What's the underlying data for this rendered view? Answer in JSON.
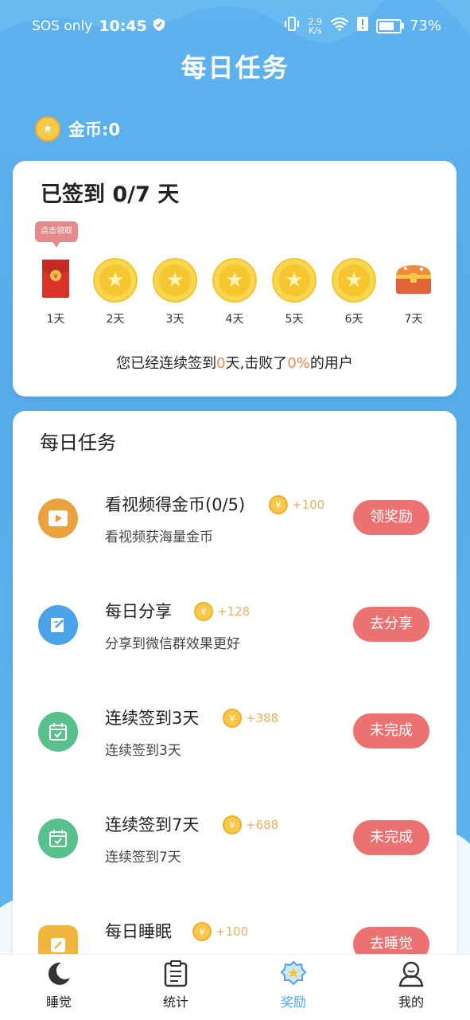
{
  "status_bar": {
    "carrier": "SOS only",
    "time": "10:45",
    "net_speed_top": "2.9",
    "net_speed_bottom": "K/s",
    "battery": "73%",
    "battery_level": 0.73
  },
  "header": {
    "title": "每日任务"
  },
  "wallet": {
    "coins_label": "金币:0"
  },
  "signin": {
    "heading": "已签到 0/7 天",
    "tip": "点击领取",
    "days": [
      {
        "label": "1天",
        "icon": "red-envelope-icon"
      },
      {
        "label": "2天",
        "icon": "star-coin-icon"
      },
      {
        "label": "3天",
        "icon": "star-coin-icon"
      },
      {
        "label": "4天",
        "icon": "star-coin-icon"
      },
      {
        "label": "5天",
        "icon": "star-coin-icon"
      },
      {
        "label": "6天",
        "icon": "star-coin-icon"
      },
      {
        "label": "7天",
        "icon": "treasure-chest-icon"
      }
    ],
    "streak_prefix": "您已经连续签到",
    "streak_days": "0",
    "streak_mid": "天,击败了",
    "streak_percent": "0%",
    "streak_suffix": "的用户"
  },
  "tasks": {
    "heading": "每日任务",
    "items": [
      {
        "name": "看视频得金币(0/5)",
        "reward": "+100",
        "desc": "看视频获海量金币",
        "button": "领奖励",
        "icon": "video-play-icon",
        "color": "#eaa13e"
      },
      {
        "name": "每日分享",
        "reward": "+128",
        "desc": "分享到微信群效果更好",
        "button": "去分享",
        "icon": "share-note-icon",
        "color": "#4aa3e8"
      },
      {
        "name": "连续签到3天",
        "reward": "+388",
        "desc": "连续签到3天",
        "button": "未完成",
        "icon": "calendar-check-icon",
        "color": "#58c08a"
      },
      {
        "name": "连续签到7天",
        "reward": "+688",
        "desc": "连续签到7天",
        "button": "未完成",
        "icon": "calendar-check-icon",
        "color": "#58c08a"
      },
      {
        "name": "每日睡眠",
        "reward": "+100",
        "desc": "",
        "button": "去睡觉",
        "icon": "sleep-note-icon",
        "color": "#f1b63c"
      }
    ]
  },
  "tabbar": {
    "items": [
      {
        "label": "睡觉",
        "icon": "moon-icon"
      },
      {
        "label": "统计",
        "icon": "clipboard-icon"
      },
      {
        "label": "奖励",
        "icon": "award-star-icon"
      },
      {
        "label": "我的",
        "icon": "user-icon"
      }
    ],
    "active_index": 2,
    "accent": "#4ca6e6"
  },
  "colors": {
    "primary_blue": "#5db2ef",
    "button_red": "#ec7272",
    "coin_gold": "#f6c94b",
    "highlight_orange": "#ef8a48"
  }
}
